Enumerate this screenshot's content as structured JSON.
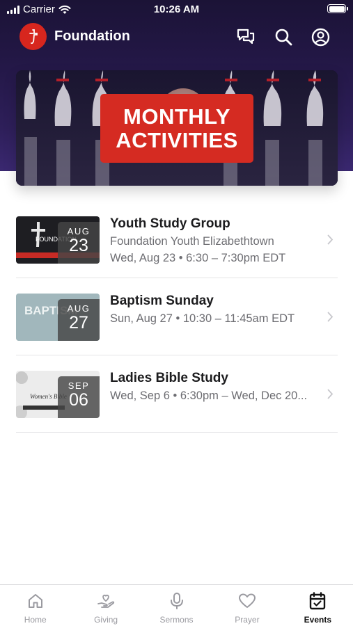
{
  "status_bar": {
    "carrier": "Carrier",
    "time": "10:26 AM"
  },
  "header": {
    "title": "Foundation",
    "icons": [
      "chat-icon",
      "search-icon",
      "profile-icon"
    ]
  },
  "banner": {
    "line1": "MONTHLY",
    "line2": "ACTIVITIES"
  },
  "events": [
    {
      "title": "Youth Study Group",
      "line1": "Foundation Youth Elizabethtown",
      "line2": "Wed, Aug 23 • 6:30 – 7:30pm EDT",
      "month": "AUG",
      "day": "23",
      "thumb_text": "FOUNDATION"
    },
    {
      "title": "Baptism Sunday",
      "line1": "Sun, Aug 27 • 10:30 – 11:45am EDT",
      "month": "AUG",
      "day": "27",
      "thumb_text": "BAPTISM"
    },
    {
      "title": "Ladies Bible Study",
      "line1": "Wed, Sep 6 • 6:30pm – Wed, Dec 20...",
      "month": "SEP",
      "day": "06",
      "thumb_text": "Women's Bible"
    }
  ],
  "tabs": [
    {
      "label": "Home",
      "icon": "home-icon",
      "active": false
    },
    {
      "label": "Giving",
      "icon": "giving-icon",
      "active": false
    },
    {
      "label": "Sermons",
      "icon": "microphone-icon",
      "active": false
    },
    {
      "label": "Prayer",
      "icon": "heart-icon",
      "active": false
    },
    {
      "label": "Events",
      "icon": "calendar-icon",
      "active": true
    }
  ],
  "colors": {
    "brand_red": "#d7261e",
    "header_bg": "#241848"
  }
}
